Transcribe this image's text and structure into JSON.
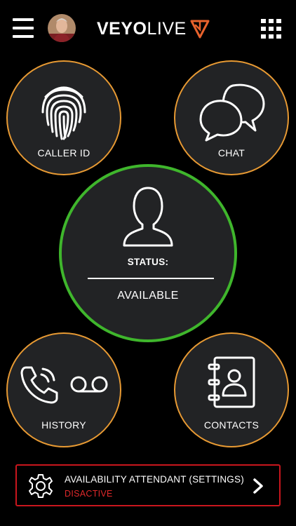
{
  "header": {
    "logo_main": "VEYO",
    "logo_sub": "LIVE",
    "brand_color": "#e8622c"
  },
  "tiles": {
    "caller_id": {
      "label": "CALLER ID",
      "icon": "fingerprint-icon"
    },
    "chat": {
      "label": "CHAT",
      "icon": "chat-bubbles-icon"
    },
    "history": {
      "label": "HISTORY",
      "icon": "phone-voicemail-icon"
    },
    "contacts": {
      "label": "CONTACTS",
      "icon": "address-book-icon"
    }
  },
  "status": {
    "title": "STATUS:",
    "value": "AVAILABLE",
    "icon": "user-silhouette-icon",
    "ring_color": "#3fb62c"
  },
  "attendant": {
    "title": "AVAILABILITY ATTENDANT (SETTINGS)",
    "status": "DISACTIVE",
    "icon": "gear-icon",
    "border_color": "#c9161d"
  },
  "colors": {
    "tile_ring": "#e89a33",
    "tile_fill": "#222325",
    "background": "#000000"
  }
}
